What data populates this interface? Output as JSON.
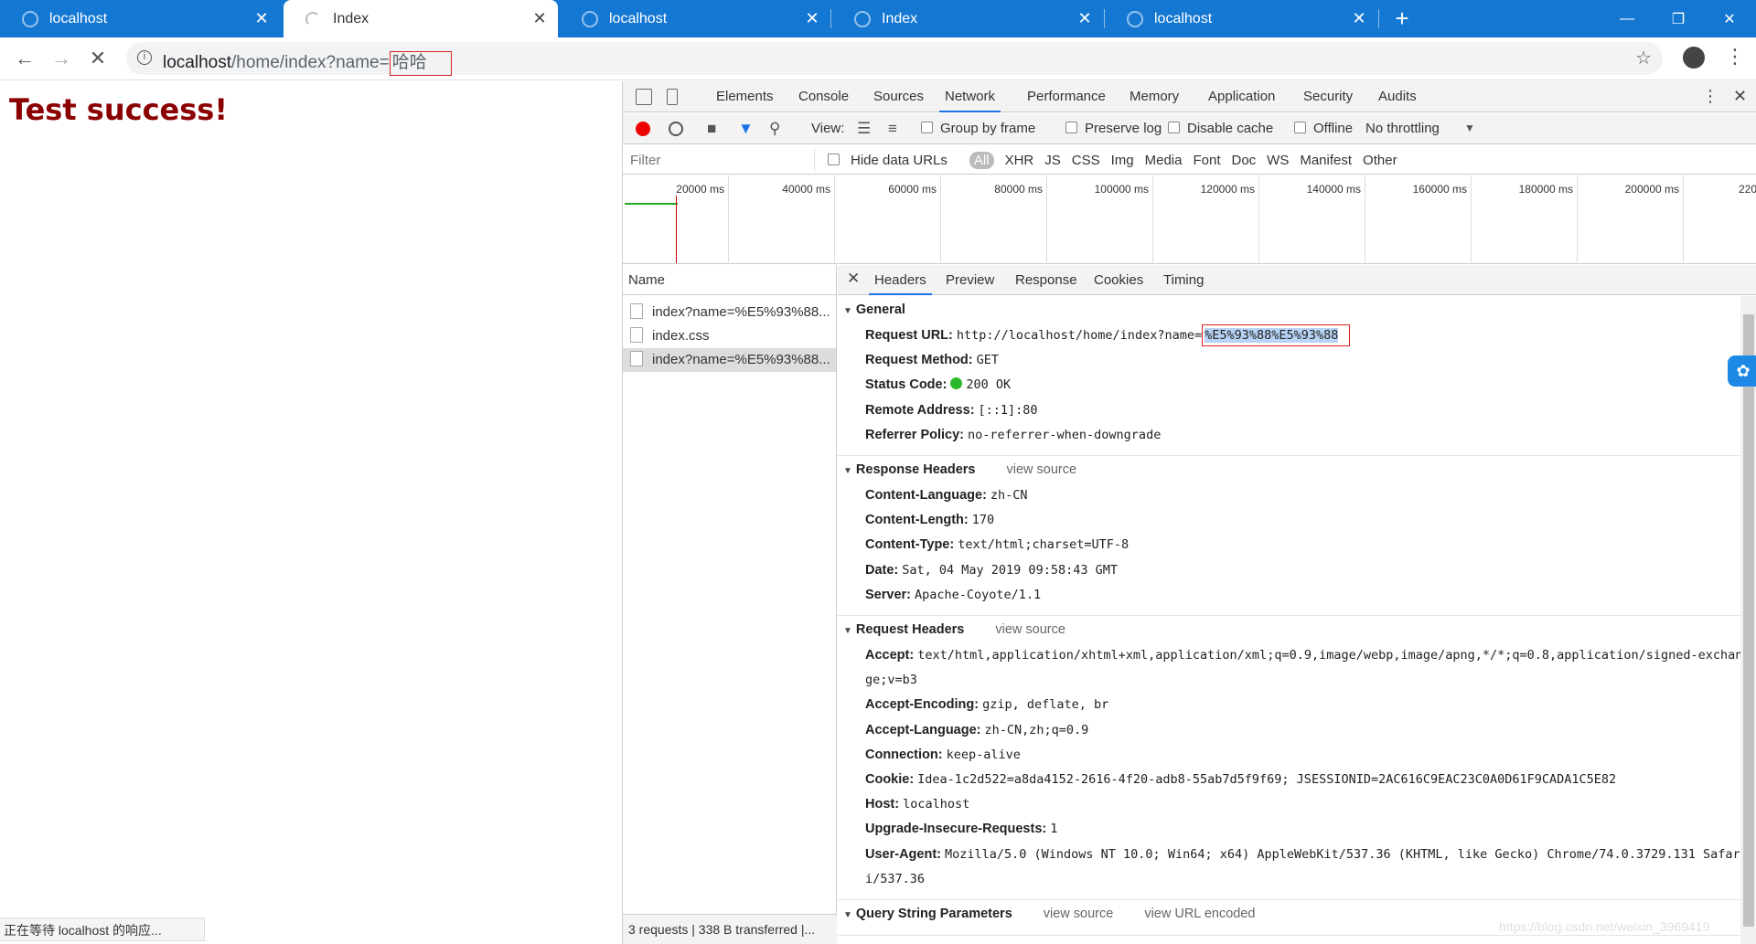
{
  "tabs": [
    {
      "label": "localhost"
    },
    {
      "label": "Index"
    },
    {
      "label": "localhost"
    },
    {
      "label": "Index"
    },
    {
      "label": "localhost"
    }
  ],
  "address": {
    "base": "localhost",
    "path": "/home/index?name=",
    "query": "哈哈"
  },
  "page": {
    "heading": "Test success!",
    "status": "正在等待 localhost 的响应..."
  },
  "devtools": {
    "tabs": [
      "Elements",
      "Console",
      "Sources",
      "Network",
      "Performance",
      "Memory",
      "Application",
      "Security",
      "Audits"
    ],
    "active_tab": "Network",
    "toolbar": {
      "view": "View:",
      "group_by_frame": "Group by frame",
      "preserve_log": "Preserve log",
      "disable_cache": "Disable cache",
      "offline": "Offline",
      "throttling": "No throttling"
    },
    "filter": {
      "placeholder": "Filter",
      "hide_data_urls": "Hide data URLs",
      "types": [
        "All",
        "XHR",
        "JS",
        "CSS",
        "Img",
        "Media",
        "Font",
        "Doc",
        "WS",
        "Manifest",
        "Other"
      ]
    },
    "timeline": [
      "20000 ms",
      "40000 ms",
      "60000 ms",
      "80000 ms",
      "100000 ms",
      "120000 ms",
      "140000 ms",
      "160000 ms",
      "180000 ms",
      "200000 ms",
      "220"
    ],
    "name_header": "Name",
    "requests": [
      "index?name=%E5%93%88...",
      "index.css",
      "index?name=%E5%93%88..."
    ],
    "summary": "3 requests  |  338 B transferred  |...",
    "detail_tabs": [
      "Headers",
      "Preview",
      "Response",
      "Cookies",
      "Timing"
    ],
    "general": {
      "title": "General",
      "request_url_label": "Request URL:",
      "request_url_base": "http://localhost/home/index?name=",
      "request_url_query": "%E5%93%88%E5%93%88",
      "rows": [
        {
          "k": "Request Method:",
          "v": "GET"
        },
        {
          "k": "Status Code:",
          "v": "200 OK"
        },
        {
          "k": "Remote Address:",
          "v": "[::1]:80"
        },
        {
          "k": "Referrer Policy:",
          "v": "no-referrer-when-downgrade"
        }
      ]
    },
    "response_headers": {
      "title": "Response Headers",
      "view_source": "view source",
      "rows": [
        {
          "k": "Content-Language:",
          "v": "zh-CN"
        },
        {
          "k": "Content-Length:",
          "v": "170"
        },
        {
          "k": "Content-Type:",
          "v": "text/html;charset=UTF-8"
        },
        {
          "k": "Date:",
          "v": "Sat, 04 May 2019 09:58:43 GMT"
        },
        {
          "k": "Server:",
          "v": "Apache-Coyote/1.1"
        }
      ]
    },
    "request_headers": {
      "title": "Request Headers",
      "view_source": "view source",
      "accept_label": "Accept:",
      "accept_value": "text/html,application/xhtml+xml,application/xml;q=0.9,image/webp,image/apng,*/*;q=0.8,application/signed-exchange;v=b3",
      "rows": [
        {
          "k": "Accept-Encoding:",
          "v": "gzip, deflate, br"
        },
        {
          "k": "Accept-Language:",
          "v": "zh-CN,zh;q=0.9"
        },
        {
          "k": "Connection:",
          "v": "keep-alive"
        },
        {
          "k": "Cookie:",
          "v": "Idea-1c2d522=a8da4152-2616-4f20-adb8-55ab7d5f9f69; JSESSIONID=2AC616C9EAC23C0A0D61F9CADA1C5E82"
        },
        {
          "k": "Host:",
          "v": "localhost"
        },
        {
          "k": "Upgrade-Insecure-Requests:",
          "v": "1"
        }
      ],
      "ua_label": "User-Agent:",
      "ua_value": "Mozilla/5.0 (Windows NT 10.0; Win64; x64) AppleWebKit/537.36 (KHTML, like Gecko) Chrome/74.0.3729.131 Safari/537.36"
    },
    "query_params": {
      "title": "Query String Parameters",
      "view_source": "view source",
      "view_url_encoded": "view URL encoded"
    }
  },
  "watermark": "https://blog.csdn.net/weixin_3969419"
}
